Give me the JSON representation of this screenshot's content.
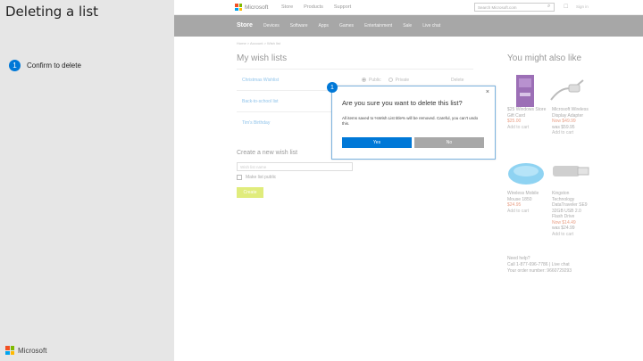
{
  "slide": {
    "title": "Deleting a list",
    "step_number": "1",
    "step_label": "Confirm to delete",
    "footer_brand": "Microsoft"
  },
  "header": {
    "brand": "Microsoft",
    "nav": [
      "Store",
      "Products",
      "Support"
    ],
    "search_placeholder": "Search Microsoft.com",
    "sign_in": "Sign in"
  },
  "storebar": {
    "label": "Store",
    "menu": [
      "Devices",
      "Software",
      "Apps",
      "Games",
      "Entertainment",
      "Sale",
      "Live chat"
    ]
  },
  "breadcrumb": "Home > Account > Wish list",
  "wishlists": {
    "heading": "My wish lists",
    "items": [
      {
        "name": "Christmas Wishlist",
        "public": "Public",
        "private": "Private",
        "delete": "Delete"
      },
      {
        "name": "Back-to-school list"
      },
      {
        "name": "Tim's Birthday"
      }
    ]
  },
  "create": {
    "heading": "Create a new wish list",
    "placeholder": "Wish list name",
    "make_public": "Make list public",
    "button": "Create"
  },
  "recommend": {
    "heading": "You might also like",
    "products": [
      {
        "name": "$25 Windows Store Gift Card",
        "price": "$25.00",
        "cart": "Add to cart"
      },
      {
        "name": "Microsoft Wireless Display Adapter",
        "price": "Now $49.99",
        "was": "was $59.95",
        "cart": "Add to cart"
      },
      {
        "name": "Wireless Mobile Mouse 1850",
        "price": "$24.95",
        "cart": "Add to cart"
      },
      {
        "name": "Kingston Technology DataTraveler SE9 32GB USB 2.0 Flash Drive",
        "price": "Now $14.49",
        "was": "was $24.99",
        "cart": "Add to cart"
      }
    ],
    "help_title": "Need help?",
    "help_line": "Call 1-877-696-7786 | Live chat",
    "order_line": "Your order number: 9660729293"
  },
  "dialog": {
    "badge": "1",
    "title": "Are you sure you want to delete this list?",
    "body": "All items saved to %Wish List title% will be removed. Careful, you can't undo this.",
    "yes": "Yes",
    "no": "No",
    "close": "×"
  },
  "colors": {
    "accent": "#0078d7",
    "storebar": "#a7a7a7",
    "create_button": "#e0ec7c"
  }
}
